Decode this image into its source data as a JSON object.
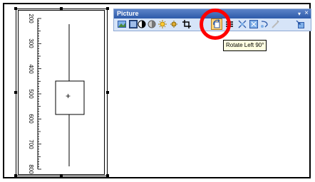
{
  "toolbar": {
    "title": "Picture",
    "menu_glyph": "▾",
    "close_glyph": "×",
    "buttons": [
      {
        "name": "insert-picture",
        "icon": "insert-picture-icon"
      },
      {
        "name": "color",
        "icon": "color-icon"
      },
      {
        "name": "more-contrast",
        "icon": "more-contrast-icon"
      },
      {
        "name": "less-contrast",
        "icon": "less-contrast-icon"
      },
      {
        "name": "more-brightness",
        "icon": "more-brightness-icon"
      },
      {
        "name": "less-brightness",
        "icon": "less-brightness-icon"
      },
      {
        "name": "crop",
        "icon": "crop-icon"
      },
      {
        "name": "rotate-left",
        "icon": "rotate-left-icon"
      },
      {
        "name": "line-style",
        "icon": "line-style-icon"
      },
      {
        "name": "compress-pictures",
        "icon": "compress-pictures-icon"
      },
      {
        "name": "format-picture",
        "icon": "format-picture-icon"
      },
      {
        "name": "text-wrapping",
        "icon": "text-wrapping-icon"
      },
      {
        "name": "set-transparent-color",
        "icon": "set-transparent-color-icon"
      },
      {
        "name": "reset-picture",
        "icon": "reset-picture-icon"
      }
    ]
  },
  "tooltip": {
    "text": "Rotate Left 90°"
  },
  "highlight_color": "#ff0000",
  "picture": {
    "axis_ticks": [
      "200",
      "300",
      "400",
      "500",
      "600",
      "700",
      "800"
    ],
    "plus_glyph": "+"
  }
}
